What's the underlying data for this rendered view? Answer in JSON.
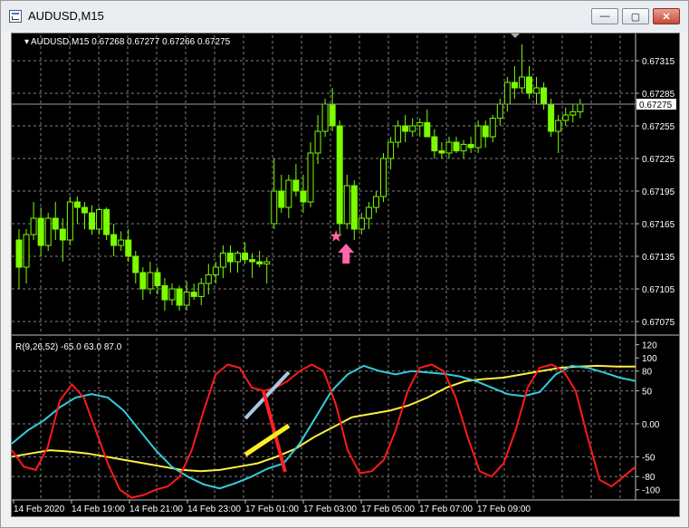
{
  "window": {
    "title": "AUDUSD,M15",
    "controls": {
      "minimize": "—",
      "maximize": "▢",
      "close": "✕"
    }
  },
  "price_panel": {
    "label": "AUDUSD,M15  0.67268 0.67277 0.67266 0.67275",
    "current_price": "0.67275",
    "price_ticks": [
      "0.67315",
      "0.67285",
      "0.67255",
      "0.67225",
      "0.67195",
      "0.67165",
      "0.67135",
      "0.67105",
      "0.67075"
    ]
  },
  "indicator_panel": {
    "label": "R(9,26,52) -65.0 63.0 87.0",
    "ticks": [
      "120",
      "100",
      "80",
      "50",
      "0.00",
      "-50",
      "-80",
      "-100"
    ]
  },
  "time_axis": {
    "labels": [
      "14 Feb 2020",
      "14 Feb 19:00",
      "14 Feb 21:00",
      "14 Feb 23:00",
      "17 Feb 01:00",
      "17 Feb 03:00",
      "17 Feb 05:00",
      "17 Feb 07:00",
      "17 Feb 09:00"
    ]
  },
  "colors": {
    "candle": "#7CFC00",
    "grid": "#808080",
    "red_line": "#ff1a1a",
    "cyan_line": "#33ccdd",
    "yellow_line": "#ffee44",
    "marker": "#ff66aa"
  },
  "chart_data": {
    "type": "candlestick",
    "y_range": [
      0.67065,
      0.6734
    ],
    "candles": [
      [
        0.6715,
        0.6716,
        0.67105,
        0.67125
      ],
      [
        0.67125,
        0.6716,
        0.6711,
        0.67155
      ],
      [
        0.67155,
        0.67185,
        0.6715,
        0.6717
      ],
      [
        0.6717,
        0.6718,
        0.67135,
        0.67145
      ],
      [
        0.67145,
        0.67175,
        0.6714,
        0.6717
      ],
      [
        0.6717,
        0.67185,
        0.6715,
        0.6716
      ],
      [
        0.6716,
        0.6717,
        0.6713,
        0.6715
      ],
      [
        0.6715,
        0.6719,
        0.67145,
        0.67185
      ],
      [
        0.67185,
        0.6719,
        0.67165,
        0.6718
      ],
      [
        0.6718,
        0.67185,
        0.6716,
        0.67175
      ],
      [
        0.67175,
        0.67182,
        0.67155,
        0.6716
      ],
      [
        0.6716,
        0.6718,
        0.67155,
        0.67178
      ],
      [
        0.67178,
        0.6718,
        0.6715,
        0.67155
      ],
      [
        0.67155,
        0.67165,
        0.67135,
        0.67145
      ],
      [
        0.67145,
        0.67158,
        0.6714,
        0.6715
      ],
      [
        0.6715,
        0.6716,
        0.6713,
        0.67135
      ],
      [
        0.67135,
        0.6714,
        0.6711,
        0.6712
      ],
      [
        0.6712,
        0.67125,
        0.67095,
        0.67105
      ],
      [
        0.67105,
        0.6713,
        0.671,
        0.6712
      ],
      [
        0.6712,
        0.67125,
        0.671,
        0.67108
      ],
      [
        0.67108,
        0.67115,
        0.67085,
        0.67095
      ],
      [
        0.67095,
        0.6711,
        0.6709,
        0.67105
      ],
      [
        0.67105,
        0.67108,
        0.67085,
        0.6709
      ],
      [
        0.6709,
        0.67112,
        0.67085,
        0.67102
      ],
      [
        0.67102,
        0.6711,
        0.67095,
        0.67098
      ],
      [
        0.67098,
        0.67115,
        0.6709,
        0.6711
      ],
      [
        0.6711,
        0.67128,
        0.671,
        0.67118
      ],
      [
        0.67118,
        0.6713,
        0.6711,
        0.67125
      ],
      [
        0.67125,
        0.67145,
        0.67115,
        0.67138
      ],
      [
        0.67138,
        0.67145,
        0.6712,
        0.6713
      ],
      [
        0.6713,
        0.6714,
        0.6712,
        0.67138
      ],
      [
        0.67138,
        0.67148,
        0.67128,
        0.67132
      ],
      [
        0.67132,
        0.67138,
        0.67115,
        0.6713
      ],
      [
        0.6713,
        0.6714,
        0.67125,
        0.67128
      ],
      [
        0.67128,
        0.67134,
        0.6711,
        0.6713
      ],
      [
        0.67165,
        0.67225,
        0.6716,
        0.67195
      ],
      [
        0.67195,
        0.6721,
        0.67175,
        0.6718
      ],
      [
        0.6718,
        0.6721,
        0.6717,
        0.67205
      ],
      [
        0.67205,
        0.6722,
        0.6719,
        0.67195
      ],
      [
        0.67195,
        0.6721,
        0.67175,
        0.67185
      ],
      [
        0.67185,
        0.6724,
        0.6718,
        0.6723
      ],
      [
        0.6723,
        0.67265,
        0.6722,
        0.6725
      ],
      [
        0.6725,
        0.6728,
        0.67245,
        0.67275
      ],
      [
        0.67275,
        0.6729,
        0.6725,
        0.67255
      ],
      [
        0.67255,
        0.6726,
        0.67155,
        0.67165
      ],
      [
        0.67165,
        0.6721,
        0.6716,
        0.672
      ],
      [
        0.672,
        0.67205,
        0.6715,
        0.6716
      ],
      [
        0.6716,
        0.67175,
        0.67155,
        0.6717
      ],
      [
        0.6717,
        0.67185,
        0.6716,
        0.6718
      ],
      [
        0.6718,
        0.67195,
        0.67175,
        0.6719
      ],
      [
        0.6719,
        0.6723,
        0.67185,
        0.67225
      ],
      [
        0.67225,
        0.67245,
        0.67215,
        0.6724
      ],
      [
        0.6724,
        0.6726,
        0.67235,
        0.67255
      ],
      [
        0.67255,
        0.67265,
        0.6724,
        0.6725
      ],
      [
        0.6725,
        0.67262,
        0.67245,
        0.67255
      ],
      [
        0.67255,
        0.67262,
        0.67245,
        0.67258
      ],
      [
        0.67258,
        0.6727,
        0.6725,
        0.67245
      ],
      [
        0.67245,
        0.67252,
        0.67225,
        0.67232
      ],
      [
        0.67232,
        0.6724,
        0.67225,
        0.6723
      ],
      [
        0.6723,
        0.67245,
        0.67225,
        0.6724
      ],
      [
        0.6724,
        0.67245,
        0.6723,
        0.67232
      ],
      [
        0.67232,
        0.67242,
        0.67225,
        0.67238
      ],
      [
        0.67238,
        0.67245,
        0.6723,
        0.67235
      ],
      [
        0.67235,
        0.6726,
        0.6723,
        0.67255
      ],
      [
        0.67255,
        0.6726,
        0.67235,
        0.67245
      ],
      [
        0.67245,
        0.67265,
        0.6724,
        0.67262
      ],
      [
        0.67262,
        0.6728,
        0.67255,
        0.67275
      ],
      [
        0.67275,
        0.673,
        0.67268,
        0.67295
      ],
      [
        0.67295,
        0.6731,
        0.6728,
        0.6729
      ],
      [
        0.6729,
        0.6733,
        0.67285,
        0.673
      ],
      [
        0.673,
        0.6731,
        0.6728,
        0.67285
      ],
      [
        0.67285,
        0.673,
        0.67275,
        0.6729
      ],
      [
        0.6729,
        0.67295,
        0.6727,
        0.67275
      ],
      [
        0.67275,
        0.6728,
        0.67245,
        0.6725
      ],
      [
        0.6725,
        0.67265,
        0.6723,
        0.6726
      ],
      [
        0.6726,
        0.67272,
        0.67255,
        0.67265
      ],
      [
        0.67265,
        0.67275,
        0.67258,
        0.67268
      ],
      [
        0.67268,
        0.6728,
        0.67262,
        0.67275
      ]
    ],
    "indicator_range": [
      -110,
      125
    ],
    "red_line": [
      -40,
      -65,
      -70,
      -35,
      35,
      60,
      40,
      -10,
      -60,
      -100,
      -112,
      -108,
      -100,
      -95,
      -80,
      -40,
      20,
      75,
      90,
      85,
      55,
      50,
      55,
      65,
      80,
      90,
      80,
      30,
      -40,
      -75,
      -72,
      -55,
      -10,
      50,
      85,
      90,
      80,
      40,
      -20,
      -72,
      -80,
      -60,
      -10,
      55,
      85,
      90,
      80,
      50,
      -20,
      -85,
      -95,
      -80,
      -65
    ],
    "cyan_line": [
      -30,
      -10,
      5,
      25,
      40,
      45,
      40,
      20,
      -10,
      -40,
      -65,
      -80,
      -92,
      -98,
      -90,
      -80,
      -68,
      -60,
      -30,
      10,
      50,
      75,
      88,
      80,
      75,
      80,
      78,
      76,
      72,
      65,
      55,
      45,
      42,
      48,
      75,
      88,
      85,
      78,
      70,
      65
    ],
    "yellow_line": [
      -50,
      -45,
      -40,
      -42,
      -45,
      -50,
      -55,
      -60,
      -65,
      -70,
      -72,
      -70,
      -65,
      -60,
      -50,
      -38,
      -20,
      -5,
      10,
      15,
      20,
      28,
      40,
      55,
      65,
      68,
      70,
      75,
      80,
      85,
      87,
      88,
      87,
      87
    ],
    "annotations": [
      {
        "type": "star",
        "price": 0.6716,
        "bar": 44
      },
      {
        "type": "arrow-up",
        "price": 0.6714,
        "bar": 45
      }
    ]
  }
}
